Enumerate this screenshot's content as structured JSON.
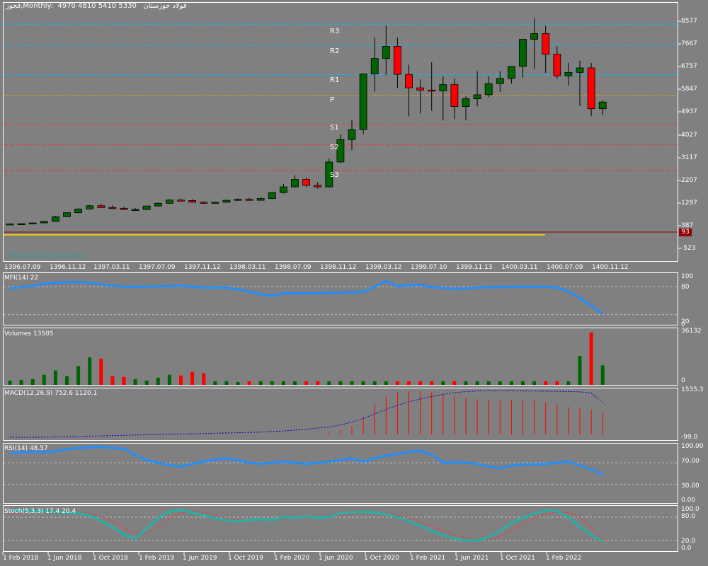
{
  "header": {
    "symbol_info": "فخوز,Monthly",
    "ohlc": "4970 4810 5410 5330",
    "name": "فولاد خوزستان"
  },
  "watermark": "Mofid Securities",
  "price_pane": {
    "y_labels": [
      "8577",
      "7667",
      "6757",
      "5847",
      "4937",
      "4027",
      "3117",
      "2207",
      "1297",
      "387",
      "-523"
    ],
    "current_badge": "93",
    "pivots": {
      "R3": "R3",
      "R2": "R2",
      "R1": "R1",
      "P": "P",
      "S1": "S1",
      "S2": "S2",
      "S3": "S3"
    },
    "x_labels": [
      "1396.07.09",
      "1396.11.12",
      "1397.03.11",
      "1397.07.09",
      "1397.11.12",
      "1398.03.11",
      "1398.07.09",
      "1398.11.12",
      "1399.03.12",
      "1399.07.10",
      "1399.11.13",
      "1400.03.11",
      "1400.07.09",
      "1400.11.12"
    ]
  },
  "mfi_pane": {
    "title": "MFI(14) 22",
    "y_labels": [
      "100",
      "80",
      "20",
      "0"
    ]
  },
  "volume_pane": {
    "title": "Volumes 13505",
    "y_labels": [
      "36132",
      "0"
    ]
  },
  "macd_pane": {
    "title": "MACD(12,26,9) 752.6 1120.1",
    "y_labels": [
      "1535.3",
      "-99.0"
    ]
  },
  "rsi_pane": {
    "title": "RSI(14) 48.57",
    "y_labels": [
      "100.00",
      "70.00",
      "30.00",
      "0.00"
    ]
  },
  "stoch_pane": {
    "title": "Stoch(5,3,3) 17.4 20.4",
    "y_labels": [
      "100.0",
      "80.0",
      "20.0",
      "0.0"
    ]
  },
  "time_axis": [
    "1 Feb 2018",
    "1 Jun 2018",
    "1 Oct 2018",
    "1 Feb 2019",
    "1 Jun 2019",
    "1 Oct 2019",
    "1 Feb 2020",
    "1 Jun 2020",
    "1 Oct 2020",
    "1 Feb 2021",
    "1 Jun 2021",
    "1 Oct 2021",
    "1 Feb 2022"
  ],
  "colors": {
    "bull": "#006400",
    "bear": "#ff0000",
    "bg": "#808080",
    "grid": "#c0c0c0",
    "line": "#1e90ff",
    "signal": "#0000c8",
    "stoch": "#20b2aa",
    "stoch_signal": "#ff3030",
    "r_lines": "#00bfff",
    "s_lines": "#ff3030",
    "p_line": "#ffa500"
  },
  "chart_data": {
    "type": "candlestick",
    "categories": [
      "2017-09",
      "2017-10",
      "2017-11",
      "2017-12",
      "2018-01",
      "2018-02",
      "2018-03",
      "2018-04",
      "2018-05",
      "2018-06",
      "2018-07",
      "2018-08",
      "2018-09",
      "2018-10",
      "2018-11",
      "2018-12",
      "2019-01",
      "2019-02",
      "2019-03",
      "2019-04",
      "2019-05",
      "2019-06",
      "2019-07",
      "2019-08",
      "2019-09",
      "2019-10",
      "2019-11",
      "2019-12",
      "2020-01",
      "2020-02",
      "2020-03",
      "2020-04",
      "2020-05",
      "2020-06",
      "2020-07",
      "2020-08",
      "2020-09",
      "2020-10",
      "2020-11",
      "2020-12",
      "2021-01",
      "2021-02",
      "2021-03",
      "2021-04",
      "2021-05",
      "2021-06",
      "2021-07",
      "2021-08",
      "2021-09",
      "2021-10",
      "2021-11",
      "2021-12",
      "2022-01"
    ],
    "open": [
      420,
      430,
      440,
      470,
      530,
      720,
      880,
      1030,
      1160,
      1090,
      1060,
      1010,
      1010,
      1150,
      1260,
      1390,
      1370,
      1300,
      1290,
      1300,
      1380,
      1420,
      1380,
      1450,
      1690,
      1920,
      2220,
      1980,
      1920,
      2920,
      3820,
      4220,
      6460,
      7080,
      7570,
      6440,
      5900,
      5810,
      5780,
      6030,
      5150,
      5460,
      5620,
      6070,
      6280,
      6760,
      7850,
      8080,
      7250,
      6380,
      6520,
      6700,
      5060
    ],
    "high": [
      440,
      450,
      470,
      550,
      760,
      900,
      1060,
      1190,
      1230,
      1180,
      1120,
      1070,
      1170,
      1290,
      1420,
      1450,
      1420,
      1340,
      1320,
      1400,
      1460,
      1480,
      1490,
      1720,
      2040,
      2380,
      2300,
      2110,
      3060,
      4040,
      4600,
      5730,
      7920,
      8400,
      7920,
      6830,
      6230,
      6930,
      6360,
      6280,
      5560,
      6570,
      6360,
      6570,
      6590,
      7200,
      8700,
      8390,
      7570,
      6910,
      6990,
      6900,
      5410
    ],
    "low": [
      400,
      410,
      430,
      460,
      520,
      700,
      860,
      1010,
      1080,
      1030,
      1000,
      980,
      990,
      1130,
      1240,
      1340,
      1300,
      1260,
      1260,
      1280,
      1360,
      1380,
      1370,
      1430,
      1650,
      1880,
      1920,
      1850,
      1880,
      2880,
      3400,
      4040,
      5750,
      6420,
      5900,
      4750,
      4870,
      4980,
      4590,
      4640,
      4600,
      5160,
      5520,
      5740,
      6070,
      6310,
      6660,
      6500,
      6260,
      5980,
      5170,
      4760,
      4810
    ],
    "close": [
      430,
      440,
      470,
      530,
      720,
      880,
      1030,
      1160,
      1090,
      1060,
      1010,
      1010,
      1150,
      1260,
      1390,
      1370,
      1300,
      1290,
      1300,
      1380,
      1420,
      1380,
      1450,
      1690,
      1920,
      2220,
      1980,
      1920,
      2920,
      3820,
      4220,
      6460,
      7080,
      7570,
      6440,
      5900,
      5810,
      5780,
      6030,
      5150,
      5460,
      5620,
      6070,
      6280,
      6760,
      7850,
      8080,
      7250,
      6380,
      6520,
      6700,
      5060,
      5330
    ],
    "ylim": [
      -523,
      8800
    ],
    "hlines": {
      "R3": 8460,
      "R2": 7620,
      "R1": 6430,
      "P": 5600,
      "S1": 4430,
      "S2": 3620,
      "S3": 2570
    },
    "volumes": [
      3000,
      3500,
      4000,
      7000,
      10000,
      6000,
      13000,
      19000,
      18000,
      6000,
      5500,
      4000,
      3000,
      5000,
      7000,
      6500,
      9000,
      8000,
      2500,
      2500,
      2000,
      2500,
      2500,
      2500,
      2500,
      2500,
      2500,
      2500,
      2500,
      2500,
      2500,
      2500,
      2500,
      2500,
      2500,
      2500,
      2500,
      2500,
      2500,
      2500,
      2500,
      2500,
      2500,
      2500,
      2500,
      2500,
      2500,
      2500,
      2500,
      2500,
      20000,
      36132,
      13505
    ],
    "mfi": [
      76,
      79,
      82,
      86,
      88,
      89,
      90,
      88,
      85,
      82,
      80,
      80,
      80,
      81,
      81,
      82,
      80,
      78,
      78,
      78,
      74,
      69,
      64,
      60,
      66,
      66,
      66,
      66,
      67,
      67,
      68,
      69,
      80,
      92,
      81,
      83,
      84,
      79,
      77,
      76,
      76,
      78,
      79,
      79,
      80,
      80,
      80,
      80,
      78,
      70,
      55,
      40,
      22
    ],
    "macd_hist": [
      0,
      0,
      0,
      0,
      0,
      0,
      0,
      0,
      0,
      0,
      0,
      0,
      0,
      0,
      0,
      0,
      0,
      0,
      0,
      0,
      0,
      0,
      0,
      0,
      0,
      0,
      0,
      0,
      0,
      0,
      0,
      0,
      0,
      0,
      0,
      0,
      0,
      0,
      0,
      0,
      0,
      0,
      0,
      0,
      0,
      0,
      0,
      0,
      0,
      0,
      0,
      0,
      0
    ],
    "macd_signal": [
      -99,
      -99,
      -99,
      -95,
      -90,
      -80,
      -70,
      -60,
      -50,
      -40,
      -30,
      -20,
      -10,
      0,
      10,
      15,
      20,
      30,
      40,
      50,
      60,
      70,
      80,
      100,
      120,
      150,
      180,
      220,
      260,
      330,
      430,
      560,
      720,
      880,
      1020,
      1140,
      1240,
      1330,
      1400,
      1460,
      1500,
      1520,
      1530,
      1535,
      1530,
      1520,
      1515,
      1510,
      1505,
      1500,
      1490,
      1450,
      1120
    ],
    "macd_main": [
      0,
      0,
      0,
      0,
      0,
      0,
      0,
      0,
      0,
      0,
      0,
      0,
      0,
      0,
      0,
      0,
      0,
      0,
      0,
      0,
      0,
      0,
      0,
      0,
      0,
      0,
      0,
      0,
      60,
      140,
      280,
      610,
      1080,
      1330,
      1460,
      1510,
      1510,
      1470,
      1420,
      1340,
      1280,
      1240,
      1210,
      1200,
      1190,
      1180,
      1170,
      1120,
      1050,
      960,
      900,
      860,
      752.6
    ],
    "rsi": [
      88,
      89,
      90,
      90,
      91,
      95,
      97,
      98,
      99,
      97,
      96,
      84,
      75,
      70,
      66,
      63,
      68,
      72,
      76,
      78,
      75,
      70,
      68,
      70,
      72,
      70,
      68,
      70,
      72,
      75,
      78,
      72,
      78,
      83,
      86,
      90,
      92,
      85,
      70,
      71,
      70,
      68,
      63,
      60,
      65,
      67,
      67,
      68,
      70,
      72,
      65,
      58,
      48.57
    ],
    "stoch_k": [
      95,
      96,
      97,
      95,
      94,
      92,
      90,
      85,
      70,
      55,
      35,
      25,
      50,
      78,
      95,
      98,
      92,
      85,
      78,
      72,
      70,
      72,
      75,
      73,
      80,
      78,
      82,
      78,
      80,
      90,
      92,
      94,
      92,
      88,
      80,
      70,
      58,
      45,
      34,
      25,
      20,
      20,
      28,
      45,
      65,
      78,
      90,
      97,
      96,
      80,
      55,
      35,
      17.4
    ],
    "stoch_d": [
      90,
      92,
      95,
      96,
      95,
      94,
      92,
      89,
      82,
      70,
      52,
      38,
      40,
      55,
      75,
      90,
      95,
      92,
      85,
      78,
      73,
      71,
      73,
      73,
      76,
      77,
      79,
      80,
      80,
      84,
      88,
      92,
      93,
      91,
      86,
      79,
      68,
      56,
      45,
      35,
      27,
      22,
      23,
      31,
      46,
      63,
      78,
      88,
      94,
      91,
      78,
      55,
      20.4
    ]
  }
}
